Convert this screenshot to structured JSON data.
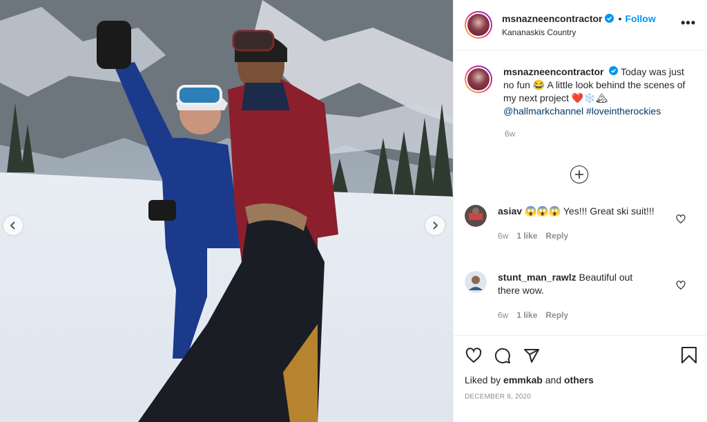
{
  "post": {
    "username": "msnazneencontractor",
    "follow_label": "Follow",
    "dot": "•",
    "location": "Kananaskis Country",
    "more_label": "•••"
  },
  "caption": {
    "username": "msnazneencontractor",
    "text_part1": "Today was just no fun 😂 A little look behind the scenes of my next project ❤️❄️🏔",
    "mention": "@hallmarkchannel",
    "hashtag": "#loveintherockies",
    "time": "6w"
  },
  "comments": [
    {
      "username": "asiav",
      "text": "😱😱😱 Yes!!! Great ski suit!!!",
      "time": "6w",
      "likes": "1 like",
      "reply": "Reply"
    },
    {
      "username": "stunt_man_rawlz",
      "text": "Beautiful out there wow.",
      "time": "6w",
      "likes": "1 like",
      "reply": "Reply"
    }
  ],
  "footer": {
    "liked_prefix": "Liked by",
    "liked_user": "emmkab",
    "liked_and": "and",
    "liked_others": "others",
    "date": "DECEMBER 8, 2020"
  },
  "colors": {
    "accent": "#0095f6",
    "hashtag": "#00376b",
    "muted": "#8e8e8e",
    "text": "#262626"
  },
  "icons": [
    "verified-badge",
    "add-comment-icon",
    "heart-icon",
    "comment-icon",
    "share-icon",
    "bookmark-icon",
    "chevron-left-icon",
    "chevron-right-icon"
  ]
}
